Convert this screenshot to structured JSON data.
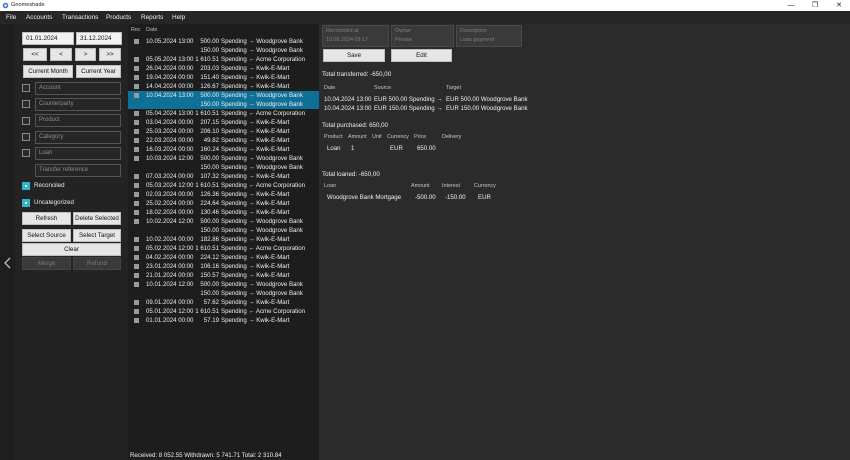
{
  "window": {
    "title": "Gnomeshade",
    "minimize": "—",
    "maximize": "❐",
    "close": "✕"
  },
  "menu": {
    "items": [
      "File",
      "Accounts",
      "Transactions",
      "Products",
      "Reports",
      "Help"
    ]
  },
  "filters": {
    "from_date": "01.01.2024",
    "to_date": "31.12.2024",
    "nav": [
      "<<",
      "<",
      ">",
      ">>"
    ],
    "current_month": "Current Month",
    "current_year": "Current Year",
    "account_placeholder": "Account",
    "counterparty_placeholder": "Counterparty",
    "product_placeholder": "Product",
    "category_placeholder": "Category",
    "loan_placeholder": "Loan",
    "transfer_reference_placeholder": "Transfer reference",
    "reconciled_label": "Reconciled",
    "uncategorized_label": "Uncategorized",
    "refresh": "Refresh",
    "delete_selected": "Delete Selected",
    "select_source": "Select Source",
    "select_target": "Select Target",
    "clear": "Clear",
    "merge": "Merge",
    "refund": "Refund"
  },
  "list": {
    "header_rec": "Rec",
    "header_date": "Date",
    "rows": [
      {
        "date": "10.05.2024 13:00",
        "amount": "500.00",
        "desc": "Spending → Woodgrove Bank",
        "check": true,
        "selected": false
      },
      {
        "date": "",
        "amount": "150.00",
        "desc": "Spending → Woodgrove Bank",
        "check": false,
        "selected": false
      },
      {
        "date": "05.05.2024 13:00",
        "amount": "1 610.51",
        "desc": "Spending ← Acme Corporation",
        "check": true,
        "selected": false
      },
      {
        "date": "26.04.2024 00:00",
        "amount": "203.03",
        "desc": "Spending → Kwik-E-Mart",
        "check": true,
        "selected": false
      },
      {
        "date": "19.04.2024 00:00",
        "amount": "151.40",
        "desc": "Spending → Kwik-E-Mart",
        "check": true,
        "selected": false
      },
      {
        "date": "14.04.2024 00:00",
        "amount": "126.67",
        "desc": "Spending → Kwik-E-Mart",
        "check": true,
        "selected": false
      },
      {
        "date": "10.04.2024 13:00",
        "amount": "500.00",
        "desc": "Spending → Woodgrove Bank",
        "check": true,
        "selected": true
      },
      {
        "date": "",
        "amount": "150.00",
        "desc": "Spending → Woodgrove Bank",
        "check": false,
        "selected": true
      },
      {
        "date": "05.04.2024 13:00",
        "amount": "1 610.51",
        "desc": "Spending ← Acme Corporation",
        "check": true,
        "selected": false
      },
      {
        "date": "03.04.2024 00:00",
        "amount": "207.15",
        "desc": "Spending → Kwik-E-Mart",
        "check": true,
        "selected": false
      },
      {
        "date": "25.03.2024 00:00",
        "amount": "206.10",
        "desc": "Spending → Kwik-E-Mart",
        "check": true,
        "selected": false
      },
      {
        "date": "22.03.2024 00:00",
        "amount": "49.82",
        "desc": "Spending → Kwik-E-Mart",
        "check": true,
        "selected": false
      },
      {
        "date": "16.03.2024 00:00",
        "amount": "160.24",
        "desc": "Spending → Kwik-E-Mart",
        "check": true,
        "selected": false
      },
      {
        "date": "10.03.2024 12:00",
        "amount": "500.00",
        "desc": "Spending → Woodgrove Bank",
        "check": true,
        "selected": false
      },
      {
        "date": "",
        "amount": "150.00",
        "desc": "Spending → Woodgrove Bank",
        "check": false,
        "selected": false
      },
      {
        "date": "07.03.2024 00:00",
        "amount": "107.32",
        "desc": "Spending → Kwik-E-Mart",
        "check": true,
        "selected": false
      },
      {
        "date": "05.03.2024 12:00",
        "amount": "1 610.51",
        "desc": "Spending ← Acme Corporation",
        "check": true,
        "selected": false
      },
      {
        "date": "02.03.2024 00:00",
        "amount": "126.36",
        "desc": "Spending → Kwik-E-Mart",
        "check": true,
        "selected": false
      },
      {
        "date": "25.02.2024 00:00",
        "amount": "224.64",
        "desc": "Spending → Kwik-E-Mart",
        "check": true,
        "selected": false
      },
      {
        "date": "18.02.2024 00:00",
        "amount": "130.46",
        "desc": "Spending → Kwik-E-Mart",
        "check": true,
        "selected": false
      },
      {
        "date": "10.02.2024 12:00",
        "amount": "500.00",
        "desc": "Spending → Woodgrove Bank",
        "check": true,
        "selected": false
      },
      {
        "date": "",
        "amount": "150.00",
        "desc": "Spending → Woodgrove Bank",
        "check": false,
        "selected": false
      },
      {
        "date": "10.02.2024 00:00",
        "amount": "182.86",
        "desc": "Spending → Kwik-E-Mart",
        "check": true,
        "selected": false
      },
      {
        "date": "05.02.2024 12:00",
        "amount": "1 610.51",
        "desc": "Spending ← Acme Corporation",
        "check": true,
        "selected": false
      },
      {
        "date": "04.02.2024 00:00",
        "amount": "224.12",
        "desc": "Spending → Kwik-E-Mart",
        "check": true,
        "selected": false
      },
      {
        "date": "23.01.2024 00:00",
        "amount": "106.16",
        "desc": "Spending → Kwik-E-Mart",
        "check": true,
        "selected": false
      },
      {
        "date": "21.01.2024 00:00",
        "amount": "150.57",
        "desc": "Spending → Kwik-E-Mart",
        "check": true,
        "selected": false
      },
      {
        "date": "10.01.2024 12:00",
        "amount": "500.00",
        "desc": "Spending → Woodgrove Bank",
        "check": true,
        "selected": false
      },
      {
        "date": "",
        "amount": "150.00",
        "desc": "Spending → Woodgrove Bank",
        "check": false,
        "selected": false
      },
      {
        "date": "09.01.2024 00:00",
        "amount": "57.62",
        "desc": "Spending → Kwik-E-Mart",
        "check": true,
        "selected": false
      },
      {
        "date": "05.01.2024 12:00",
        "amount": "1 610.51",
        "desc": "Spending ← Acme Corporation",
        "check": true,
        "selected": false
      },
      {
        "date": "01.01.2024 00:00",
        "amount": "57.19",
        "desc": "Spending → Kwik-E-Mart",
        "check": true,
        "selected": false
      }
    ],
    "footer": "Received: 8 052.55    Withdrawn: 5 741.71    Total: 2 310.84"
  },
  "detail": {
    "reconciled_at_label": "Reconciled at",
    "reconciled_at_value": "10.05.2024 09:17",
    "owner_label": "Owner",
    "owner_value": "Private",
    "description_label": "Description",
    "description_value": "Loan payment",
    "save": "Save",
    "edit": "Edit",
    "total_transferred": "Total transferred: -650,00",
    "transfers_headers": [
      "Date",
      "Source",
      "Target"
    ],
    "transfers": [
      {
        "date": "10.04.2024 13:00",
        "source": "EUR 500.00 Spending →",
        "target": "EUR 500.00 Woodgrove Bank"
      },
      {
        "date": "10.04.2024 13:00",
        "source": "EUR 150.00 Spending →",
        "target": "EUR 150.00 Woodgrove Bank"
      }
    ],
    "total_purchased": "Total purchased: 650,00",
    "purchase_headers": [
      "Product",
      "Amount",
      "Unit",
      "Currency",
      "Price",
      "Delivery"
    ],
    "purchase": {
      "product": "Loan",
      "amount": "1",
      "unit": "",
      "currency": "EUR",
      "price": "650.00",
      "delivery": ""
    },
    "total_loaned": "Total loaned: -650,00",
    "loan_headers": [
      "Loan",
      "Amount",
      "Interest",
      "Currency"
    ],
    "loan": {
      "loan": "Woodgrove Bank Mortgage",
      "amount": "-500.00",
      "interest": "-150.00",
      "currency": "EUR"
    }
  },
  "colors": {
    "accent": "#2fb6c4",
    "selection": "#0e7097",
    "background": "#1e1e1e"
  },
  "icons": {
    "app": "gnome-icon",
    "collapse": "chevron-left-icon"
  }
}
